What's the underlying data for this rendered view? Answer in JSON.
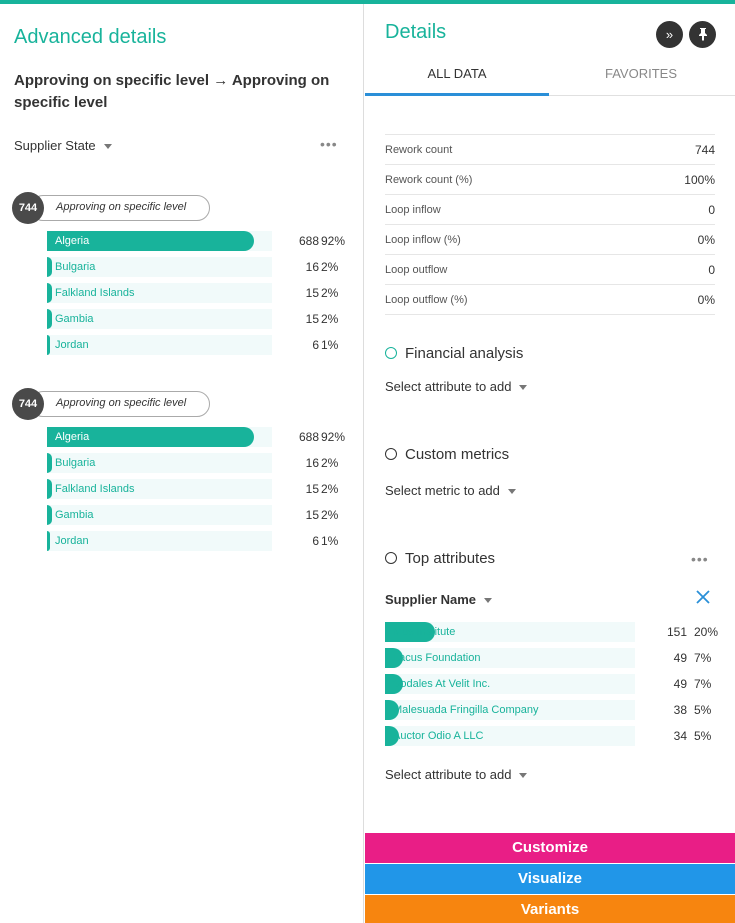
{
  "left": {
    "title": "Advanced details",
    "transition": "Approving on specific level → Approving on specific level",
    "dropdown": "Supplier State",
    "groups": [
      {
        "count": "744",
        "activity": "Approving on specific level",
        "rows": [
          {
            "label": "Algeria",
            "count": "688",
            "pct": "92%",
            "fraction": 0.92
          },
          {
            "label": "Bulgaria",
            "count": "16",
            "pct": "2%",
            "fraction": 0.02
          },
          {
            "label": "Falkland Islands",
            "count": "15",
            "pct": "2%",
            "fraction": 0.02
          },
          {
            "label": "Gambia",
            "count": "15",
            "pct": "2%",
            "fraction": 0.02
          },
          {
            "label": "Jordan",
            "count": "6",
            "pct": "1%",
            "fraction": 0.01
          }
        ]
      },
      {
        "count": "744",
        "activity": "Approving on specific level",
        "rows": [
          {
            "label": "Algeria",
            "count": "688",
            "pct": "92%",
            "fraction": 0.92
          },
          {
            "label": "Bulgaria",
            "count": "16",
            "pct": "2%",
            "fraction": 0.02
          },
          {
            "label": "Falkland Islands",
            "count": "15",
            "pct": "2%",
            "fraction": 0.02
          },
          {
            "label": "Gambia",
            "count": "15",
            "pct": "2%",
            "fraction": 0.02
          },
          {
            "label": "Jordan",
            "count": "6",
            "pct": "1%",
            "fraction": 0.01
          }
        ]
      }
    ]
  },
  "right": {
    "title": "Details",
    "tabs": [
      {
        "label": "ALL DATA",
        "active": true
      },
      {
        "label": "FAVORITES",
        "active": false
      }
    ],
    "metrics": [
      {
        "label": "Rework count",
        "value": "744"
      },
      {
        "label": "Rework count (%)",
        "value": "100%"
      },
      {
        "label": "Loop inflow",
        "value": "0"
      },
      {
        "label": "Loop inflow (%)",
        "value": "0%"
      },
      {
        "label": "Loop outflow",
        "value": "0"
      },
      {
        "label": "Loop outflow (%)",
        "value": "0%"
      }
    ],
    "financial": {
      "title": "Financial analysis",
      "select": "Select attribute to add"
    },
    "custom": {
      "title": "Custom metrics",
      "select": "Select metric to add"
    },
    "top": {
      "title": "Top attributes",
      "dropdown": "Supplier Name",
      "rows": [
        {
          "label": "Mus Institute",
          "count": "151",
          "pct": "20%",
          "fraction": 0.2
        },
        {
          "label": "Lacus Foundation",
          "count": "49",
          "pct": "7%",
          "fraction": 0.07
        },
        {
          "label": "Sodales At Velit Inc.",
          "count": "49",
          "pct": "7%",
          "fraction": 0.07
        },
        {
          "label": "Malesuada Fringilla Company",
          "count": "38",
          "pct": "5%",
          "fraction": 0.05
        },
        {
          "label": "Auctor Odio A LLC",
          "count": "34",
          "pct": "5%",
          "fraction": 0.05
        }
      ],
      "select": "Select attribute to add"
    }
  },
  "actions": {
    "customize": "Customize",
    "visualize": "Visualize",
    "variants": "Variants"
  },
  "colors": {
    "accent": "#18b39b",
    "customize": "#e91e86",
    "visualize": "#2196e8",
    "variants": "#f7850f"
  },
  "icons": {
    "expand": "double-chevron-right-icon",
    "pin": "pin-icon",
    "close": "close-icon",
    "more": "more-dots-icon"
  }
}
